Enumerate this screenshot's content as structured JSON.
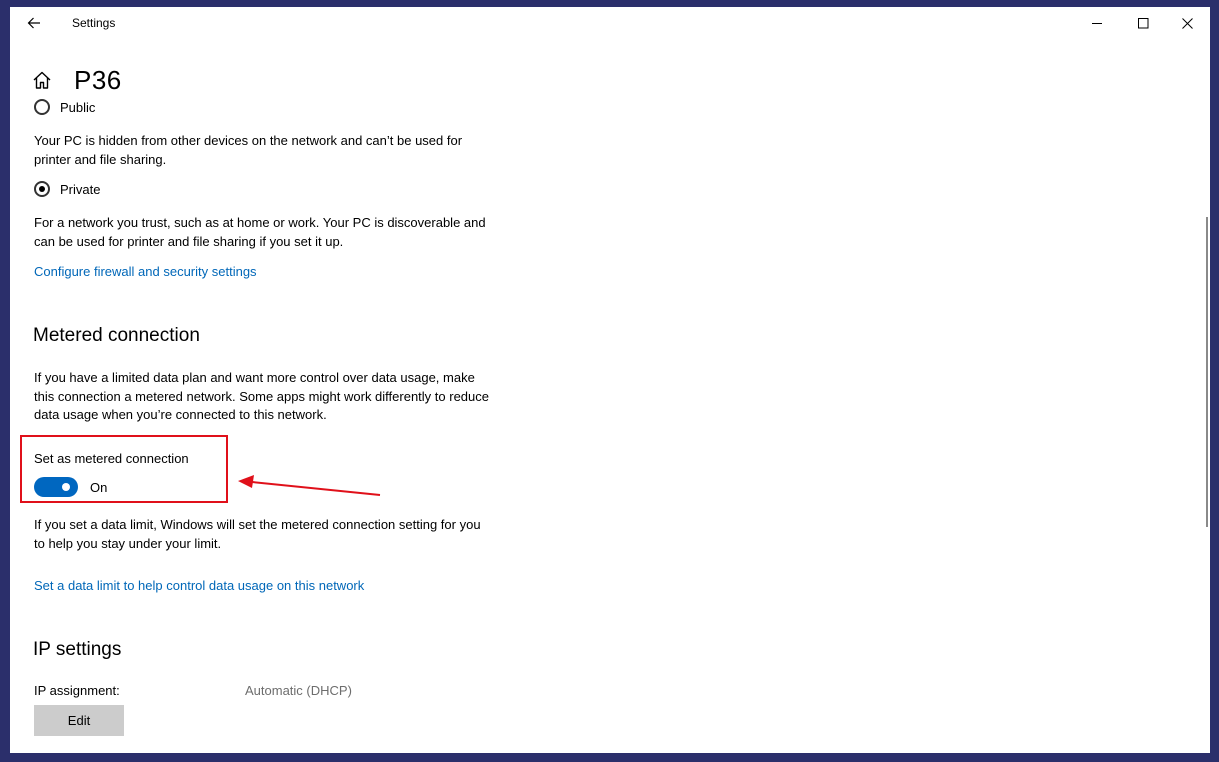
{
  "window": {
    "title": "Settings",
    "controls": {
      "minimize": "minimize-icon",
      "maximize": "maximize-icon",
      "close": "close-icon"
    }
  },
  "header": {
    "page_title": "P36",
    "home_icon": "home-icon",
    "back_icon": "back-arrow-icon"
  },
  "network_profile": {
    "public_label": "Public",
    "public_desc": "Your PC is hidden from other devices on the network and can’t be used for printer and file sharing.",
    "private_label": "Private",
    "private_desc": "For a network you trust, such as at home or work. Your PC is discoverable and can be used for printer and file sharing if you set it up.",
    "selected": "Private",
    "firewall_link": "Configure firewall and security settings"
  },
  "metered": {
    "heading": "Metered connection",
    "desc": "If you have a limited data plan and want more control over data usage, make this connection a metered network. Some apps might work differently to reduce data usage when you’re connected to this network.",
    "toggle_label": "Set as metered connection",
    "toggle_state": "On",
    "toggle_on": true,
    "limit_desc": "If you set a data limit, Windows will set the metered connection setting for you to help you stay under your limit.",
    "limit_link": "Set a data limit to help control data usage on this network"
  },
  "ip": {
    "heading": "IP settings",
    "assignment_label": "IP assignment:",
    "assignment_value": "Automatic (DHCP)",
    "edit_label": "Edit"
  },
  "colors": {
    "accent": "#0067c0",
    "link": "#0067b8",
    "annotation": "#e0101a"
  }
}
